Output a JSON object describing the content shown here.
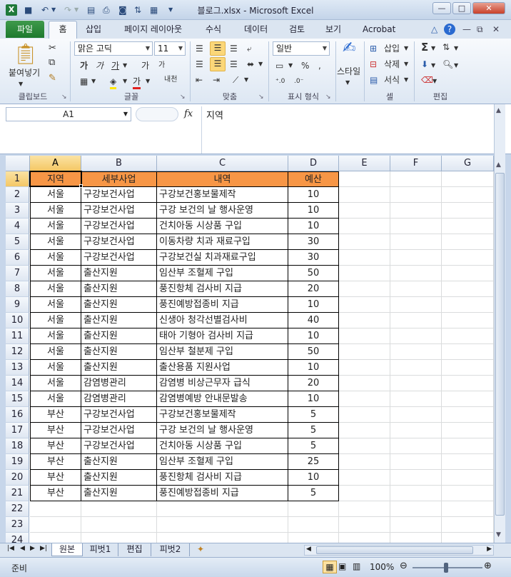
{
  "window": {
    "title": "블로그.xlsx - Microsoft Excel",
    "icons": [
      "excel-app-icon",
      "save-icon",
      "undo-icon",
      "redo-icon",
      "print-preview-icon",
      "print-icon",
      "camera-icon",
      "sort-icon",
      "paste-special-icon",
      "customize-qat-icon"
    ]
  },
  "ribbon": {
    "tabs": {
      "file": "파일",
      "home": "홈",
      "insert": "삽입",
      "page_layout": "페이지 레이아웃",
      "formulas": "수식",
      "data": "데이터",
      "review": "검토",
      "view": "보기",
      "acrobat": "Acrobat"
    },
    "clipboard": {
      "paste": "붙여넣기",
      "label": "클립보드"
    },
    "font": {
      "name": "맑은 고딕",
      "size": "11",
      "label": "글꼴",
      "bold": "가",
      "italic": "가",
      "underline": "가",
      "grow": "가",
      "shrink": "가",
      "color": "가",
      "phonetic": "내천"
    },
    "alignment": {
      "label": "맞춤"
    },
    "number": {
      "format": "일반",
      "label": "표시 형식"
    },
    "styles": {
      "label": "스타일"
    },
    "cells": {
      "insert": "삽입",
      "delete": "삭제",
      "format": "서식",
      "label": "셀"
    },
    "editing": {
      "label": "편집"
    }
  },
  "formula_bar": {
    "name_box": "A1",
    "fx": "fx",
    "value": "지역"
  },
  "columns": [
    "A",
    "B",
    "C",
    "D",
    "E",
    "F",
    "G"
  ],
  "rows": [
    "1",
    "2",
    "3",
    "4",
    "5",
    "6",
    "7",
    "8",
    "9",
    "10",
    "11",
    "12",
    "13",
    "14",
    "15",
    "16",
    "17",
    "18",
    "19",
    "20",
    "21",
    "22",
    "23",
    "24"
  ],
  "table": {
    "headers": [
      "지역",
      "세부사업",
      "내역",
      "예산"
    ],
    "records": [
      [
        "서울",
        "구강보건사업",
        "구강보건홍보물제작",
        "10"
      ],
      [
        "서울",
        "구강보건사업",
        "구강 보건의 날 행사운영",
        "10"
      ],
      [
        "서울",
        "구강보건사업",
        "건치아동 시상품 구입",
        "10"
      ],
      [
        "서울",
        "구강보건사업",
        "이동차량 치과 재료구입",
        "30"
      ],
      [
        "서울",
        "구강보건사업",
        "구강보건실 치과재료구입",
        "30"
      ],
      [
        "서울",
        "출산지원",
        "임산부 조혈제 구입",
        "50"
      ],
      [
        "서울",
        "출산지원",
        "풍진항체 검사비 지급",
        "20"
      ],
      [
        "서울",
        "출산지원",
        "풍진예방접종비 지급",
        "10"
      ],
      [
        "서울",
        "출산지원",
        "신생아 청각선별검사비",
        "40"
      ],
      [
        "서울",
        "출산지원",
        "태아 기형아 검사비 지급",
        "10"
      ],
      [
        "서울",
        "출산지원",
        "임산부 철분제 구입",
        "50"
      ],
      [
        "서울",
        "출산지원",
        "출산용품 지원사업",
        "10"
      ],
      [
        "서울",
        "감염병관리",
        "감염병 비상근무자 급식",
        "20"
      ],
      [
        "서울",
        "감염병관리",
        "감염병예방 안내문발송",
        "10"
      ],
      [
        "부산",
        "구강보건사업",
        "구강보건홍보물제작",
        "5"
      ],
      [
        "부산",
        "구강보건사업",
        "구강 보건의 날 행사운영",
        "5"
      ],
      [
        "부산",
        "구강보건사업",
        "건치아동 시상품 구입",
        "5"
      ],
      [
        "부산",
        "출산지원",
        "임산부 조혈제 구입",
        "25"
      ],
      [
        "부산",
        "출산지원",
        "풍진항체 검사비 지급",
        "10"
      ],
      [
        "부산",
        "출산지원",
        "풍진예방접종비 지급",
        "5"
      ]
    ]
  },
  "sheets": [
    "원본",
    "피벗1",
    "편집",
    "피벗2"
  ],
  "status": {
    "mode": "준비",
    "zoom": "100%"
  },
  "colors": {
    "header_fill": "#f79646",
    "selection": "#fbd779"
  }
}
